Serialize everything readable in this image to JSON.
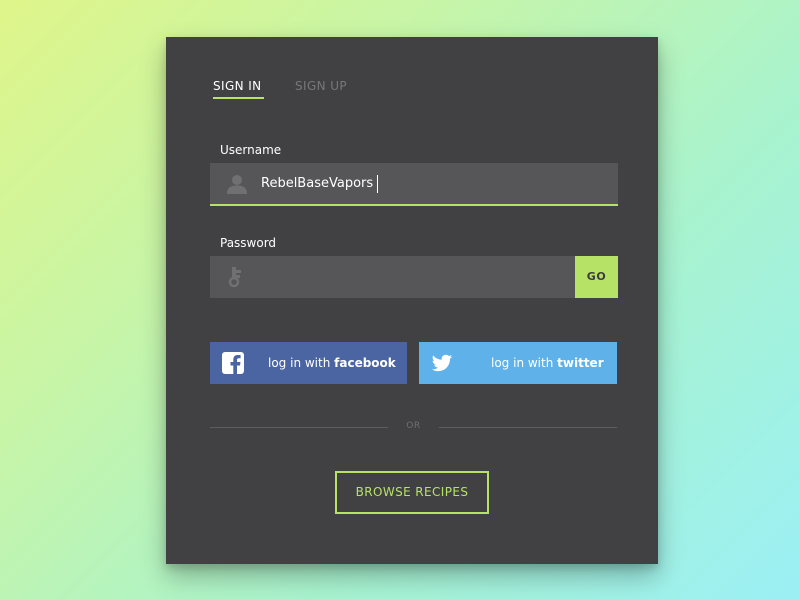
{
  "tabs": {
    "sign_in": "SIGN IN",
    "sign_up": "SIGN UP",
    "active": "SIGN IN"
  },
  "username": {
    "label": "Username",
    "value": "RebelBaseVapors",
    "icon": "user-icon"
  },
  "password": {
    "label": "Password",
    "value": "",
    "icon": "key-icon",
    "go_label": "GO"
  },
  "social": {
    "facebook": {
      "prefix": "log in with ",
      "brand": "facebook",
      "icon": "facebook-icon",
      "color": "#4a65a2"
    },
    "twitter": {
      "prefix": "log in with ",
      "brand": "twitter",
      "icon": "twitter-icon",
      "color": "#5fb2e9"
    }
  },
  "divider": {
    "text": "OR"
  },
  "browse": {
    "label": "BROWSE RECIPES"
  },
  "colors": {
    "accent": "#b6e266",
    "card": "#414143",
    "input": "#565658"
  }
}
